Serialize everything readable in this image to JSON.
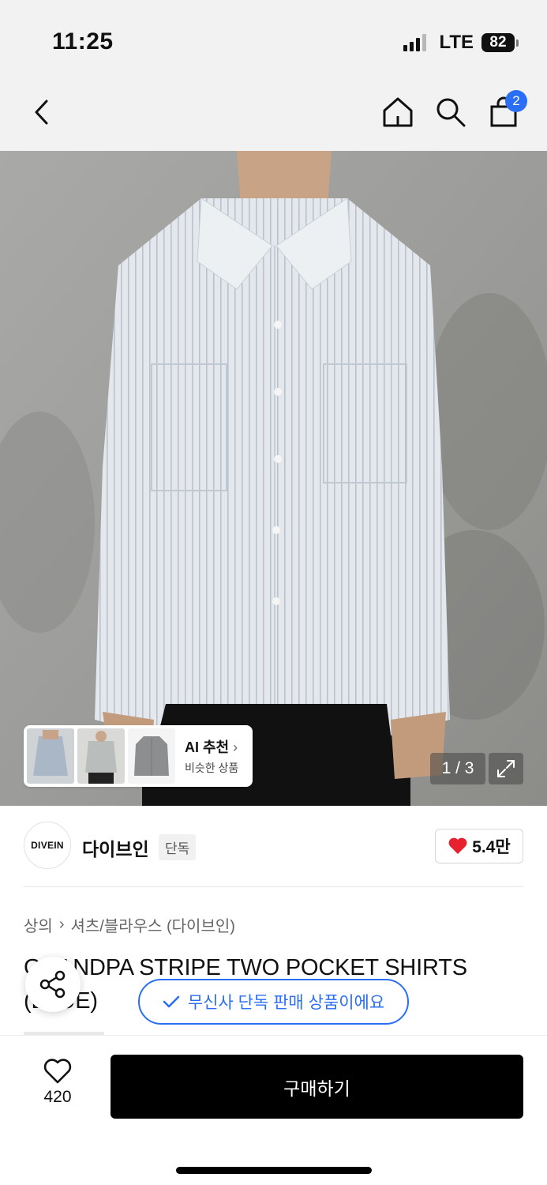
{
  "status_bar": {
    "time": "11:25",
    "network": "LTE",
    "battery": "82"
  },
  "nav": {
    "cart_count": "2"
  },
  "ai_recommend": {
    "title": "AI 추천",
    "subtitle": "비슷한 상품"
  },
  "image_pager": {
    "counter": "1 / 3"
  },
  "brand": {
    "logo_text": "DIVEIN",
    "name": "다이브인",
    "tag": "단독",
    "likes": "5.4만"
  },
  "breadcrumb": {
    "category": "상의",
    "subcategory": "셔츠/블라우스 (다이브인)"
  },
  "product": {
    "title": "GRANDPA STRIPE TWO POCKET SHIRTS (BLUE)"
  },
  "banner": {
    "text": "무신사 단독 판매 상품이에요"
  },
  "bottom": {
    "wish_count": "420",
    "buy_label": "구매하기"
  },
  "colors": {
    "accent": "#2a6ef5",
    "like_red": "#e8212e",
    "buy_black": "#000000"
  }
}
